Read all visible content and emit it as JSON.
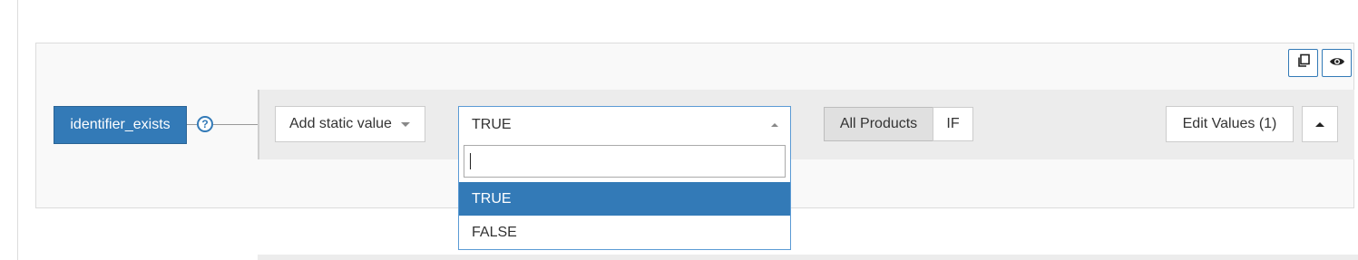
{
  "field": {
    "name": "identifier_exists",
    "help_glyph": "?"
  },
  "toolbar": {
    "copy_icon": "copy-icon",
    "preview_icon": "eye-icon"
  },
  "rule_row": {
    "static_value_button": "Add static value",
    "select": {
      "selected": "TRUE",
      "search_value": "",
      "options": [
        "TRUE",
        "FALSE"
      ],
      "highlighted_index": 0
    },
    "scope": {
      "all_products": "All Products",
      "if": "IF"
    },
    "edit_values_button": "Edit Values (1)"
  },
  "colors": {
    "accent": "#337ab7",
    "highlight": "#337ab7"
  }
}
